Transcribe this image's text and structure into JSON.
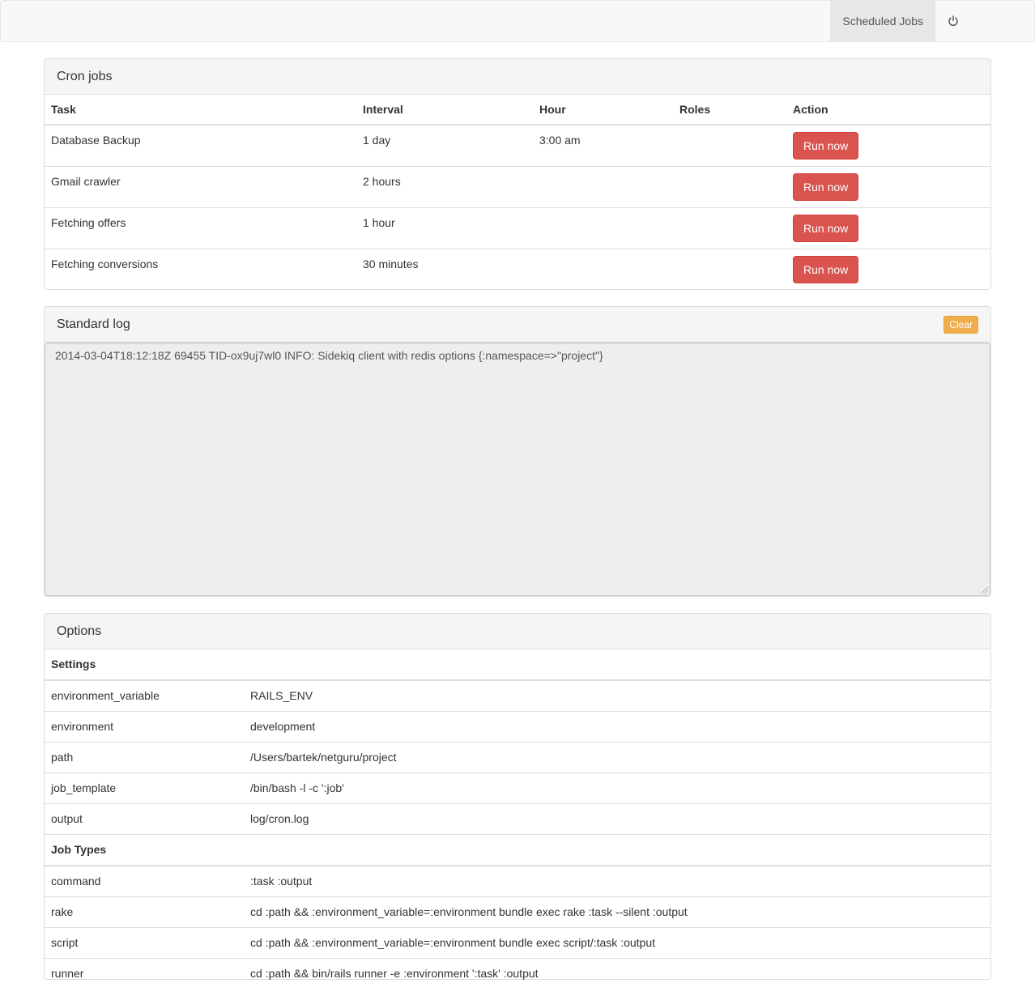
{
  "navbar": {
    "link_label": "Scheduled Jobs",
    "power_icon": "power-icon"
  },
  "cron": {
    "title": "Cron jobs",
    "columns": [
      "Task",
      "Interval",
      "Hour",
      "Roles",
      "Action"
    ],
    "rows": [
      {
        "task": "Database Backup",
        "interval": "1 day",
        "hour": "3:00 am",
        "roles": "",
        "action": "Run now"
      },
      {
        "task": "Gmail crawler",
        "interval": "2 hours",
        "hour": "",
        "roles": "",
        "action": "Run now"
      },
      {
        "task": "Fetching offers",
        "interval": "1 hour",
        "hour": "",
        "roles": "",
        "action": "Run now"
      },
      {
        "task": "Fetching conversions",
        "interval": "30 minutes",
        "hour": "",
        "roles": "",
        "action": "Run now"
      }
    ],
    "button_color": "#d9534f"
  },
  "log": {
    "title": "Standard log",
    "clear_label": "Clear",
    "clear_color": "#f0ad4e",
    "content": "2014-03-04T18:12:18Z 69455 TID-ox9uj7wl0 INFO: Sidekiq client with redis options {:namespace=>\"project\"}"
  },
  "options": {
    "title": "Options",
    "settings_heading": "Settings",
    "settings": [
      {
        "key": "environment_variable",
        "value": "RAILS_ENV"
      },
      {
        "key": "environment",
        "value": "development"
      },
      {
        "key": "path",
        "value": "/Users/bartek/netguru/project"
      },
      {
        "key": "job_template",
        "value": "/bin/bash -l -c ':job'"
      },
      {
        "key": "output",
        "value": "log/cron.log"
      }
    ],
    "job_types_heading": "Job Types",
    "job_types": [
      {
        "key": "command",
        "value": ":task :output"
      },
      {
        "key": "rake",
        "value": "cd :path && :environment_variable=:environment bundle exec rake :task --silent :output"
      },
      {
        "key": "script",
        "value": "cd :path && :environment_variable=:environment bundle exec script/:task :output"
      },
      {
        "key": "runner",
        "value": "cd :path && bin/rails runner -e :environment ':task' :output"
      }
    ]
  }
}
